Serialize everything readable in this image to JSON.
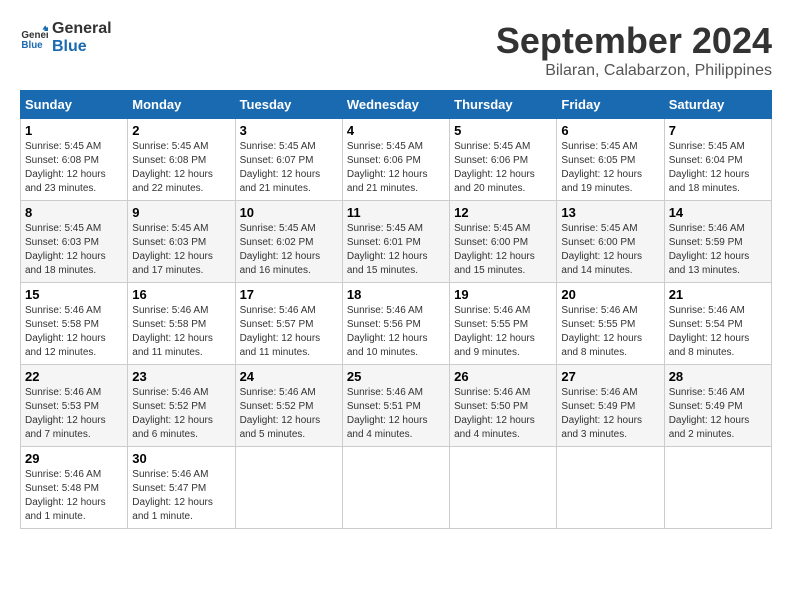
{
  "logo": {
    "line1": "General",
    "line2": "Blue"
  },
  "title": "September 2024",
  "location": "Bilaran, Calabarzon, Philippines",
  "weekdays": [
    "Sunday",
    "Monday",
    "Tuesday",
    "Wednesday",
    "Thursday",
    "Friday",
    "Saturday"
  ],
  "weeks": [
    [
      {
        "day": "1",
        "sunrise": "5:45 AM",
        "sunset": "6:08 PM",
        "daylight": "12 hours and 23 minutes."
      },
      {
        "day": "2",
        "sunrise": "5:45 AM",
        "sunset": "6:08 PM",
        "daylight": "12 hours and 22 minutes."
      },
      {
        "day": "3",
        "sunrise": "5:45 AM",
        "sunset": "6:07 PM",
        "daylight": "12 hours and 21 minutes."
      },
      {
        "day": "4",
        "sunrise": "5:45 AM",
        "sunset": "6:06 PM",
        "daylight": "12 hours and 21 minutes."
      },
      {
        "day": "5",
        "sunrise": "5:45 AM",
        "sunset": "6:06 PM",
        "daylight": "12 hours and 20 minutes."
      },
      {
        "day": "6",
        "sunrise": "5:45 AM",
        "sunset": "6:05 PM",
        "daylight": "12 hours and 19 minutes."
      },
      {
        "day": "7",
        "sunrise": "5:45 AM",
        "sunset": "6:04 PM",
        "daylight": "12 hours and 18 minutes."
      }
    ],
    [
      {
        "day": "8",
        "sunrise": "5:45 AM",
        "sunset": "6:03 PM",
        "daylight": "12 hours and 18 minutes."
      },
      {
        "day": "9",
        "sunrise": "5:45 AM",
        "sunset": "6:03 PM",
        "daylight": "12 hours and 17 minutes."
      },
      {
        "day": "10",
        "sunrise": "5:45 AM",
        "sunset": "6:02 PM",
        "daylight": "12 hours and 16 minutes."
      },
      {
        "day": "11",
        "sunrise": "5:45 AM",
        "sunset": "6:01 PM",
        "daylight": "12 hours and 15 minutes."
      },
      {
        "day": "12",
        "sunrise": "5:45 AM",
        "sunset": "6:00 PM",
        "daylight": "12 hours and 15 minutes."
      },
      {
        "day": "13",
        "sunrise": "5:45 AM",
        "sunset": "6:00 PM",
        "daylight": "12 hours and 14 minutes."
      },
      {
        "day": "14",
        "sunrise": "5:46 AM",
        "sunset": "5:59 PM",
        "daylight": "12 hours and 13 minutes."
      }
    ],
    [
      {
        "day": "15",
        "sunrise": "5:46 AM",
        "sunset": "5:58 PM",
        "daylight": "12 hours and 12 minutes."
      },
      {
        "day": "16",
        "sunrise": "5:46 AM",
        "sunset": "5:58 PM",
        "daylight": "12 hours and 11 minutes."
      },
      {
        "day": "17",
        "sunrise": "5:46 AM",
        "sunset": "5:57 PM",
        "daylight": "12 hours and 11 minutes."
      },
      {
        "day": "18",
        "sunrise": "5:46 AM",
        "sunset": "5:56 PM",
        "daylight": "12 hours and 10 minutes."
      },
      {
        "day": "19",
        "sunrise": "5:46 AM",
        "sunset": "5:55 PM",
        "daylight": "12 hours and 9 minutes."
      },
      {
        "day": "20",
        "sunrise": "5:46 AM",
        "sunset": "5:55 PM",
        "daylight": "12 hours and 8 minutes."
      },
      {
        "day": "21",
        "sunrise": "5:46 AM",
        "sunset": "5:54 PM",
        "daylight": "12 hours and 8 minutes."
      }
    ],
    [
      {
        "day": "22",
        "sunrise": "5:46 AM",
        "sunset": "5:53 PM",
        "daylight": "12 hours and 7 minutes."
      },
      {
        "day": "23",
        "sunrise": "5:46 AM",
        "sunset": "5:52 PM",
        "daylight": "12 hours and 6 minutes."
      },
      {
        "day": "24",
        "sunrise": "5:46 AM",
        "sunset": "5:52 PM",
        "daylight": "12 hours and 5 minutes."
      },
      {
        "day": "25",
        "sunrise": "5:46 AM",
        "sunset": "5:51 PM",
        "daylight": "12 hours and 4 minutes."
      },
      {
        "day": "26",
        "sunrise": "5:46 AM",
        "sunset": "5:50 PM",
        "daylight": "12 hours and 4 minutes."
      },
      {
        "day": "27",
        "sunrise": "5:46 AM",
        "sunset": "5:49 PM",
        "daylight": "12 hours and 3 minutes."
      },
      {
        "day": "28",
        "sunrise": "5:46 AM",
        "sunset": "5:49 PM",
        "daylight": "12 hours and 2 minutes."
      }
    ],
    [
      {
        "day": "29",
        "sunrise": "5:46 AM",
        "sunset": "5:48 PM",
        "daylight": "12 hours and 1 minute."
      },
      {
        "day": "30",
        "sunrise": "5:46 AM",
        "sunset": "5:47 PM",
        "daylight": "12 hours and 1 minute."
      },
      null,
      null,
      null,
      null,
      null
    ]
  ],
  "labels": {
    "sunrise": "Sunrise:",
    "sunset": "Sunset:",
    "daylight": "Daylight:"
  }
}
